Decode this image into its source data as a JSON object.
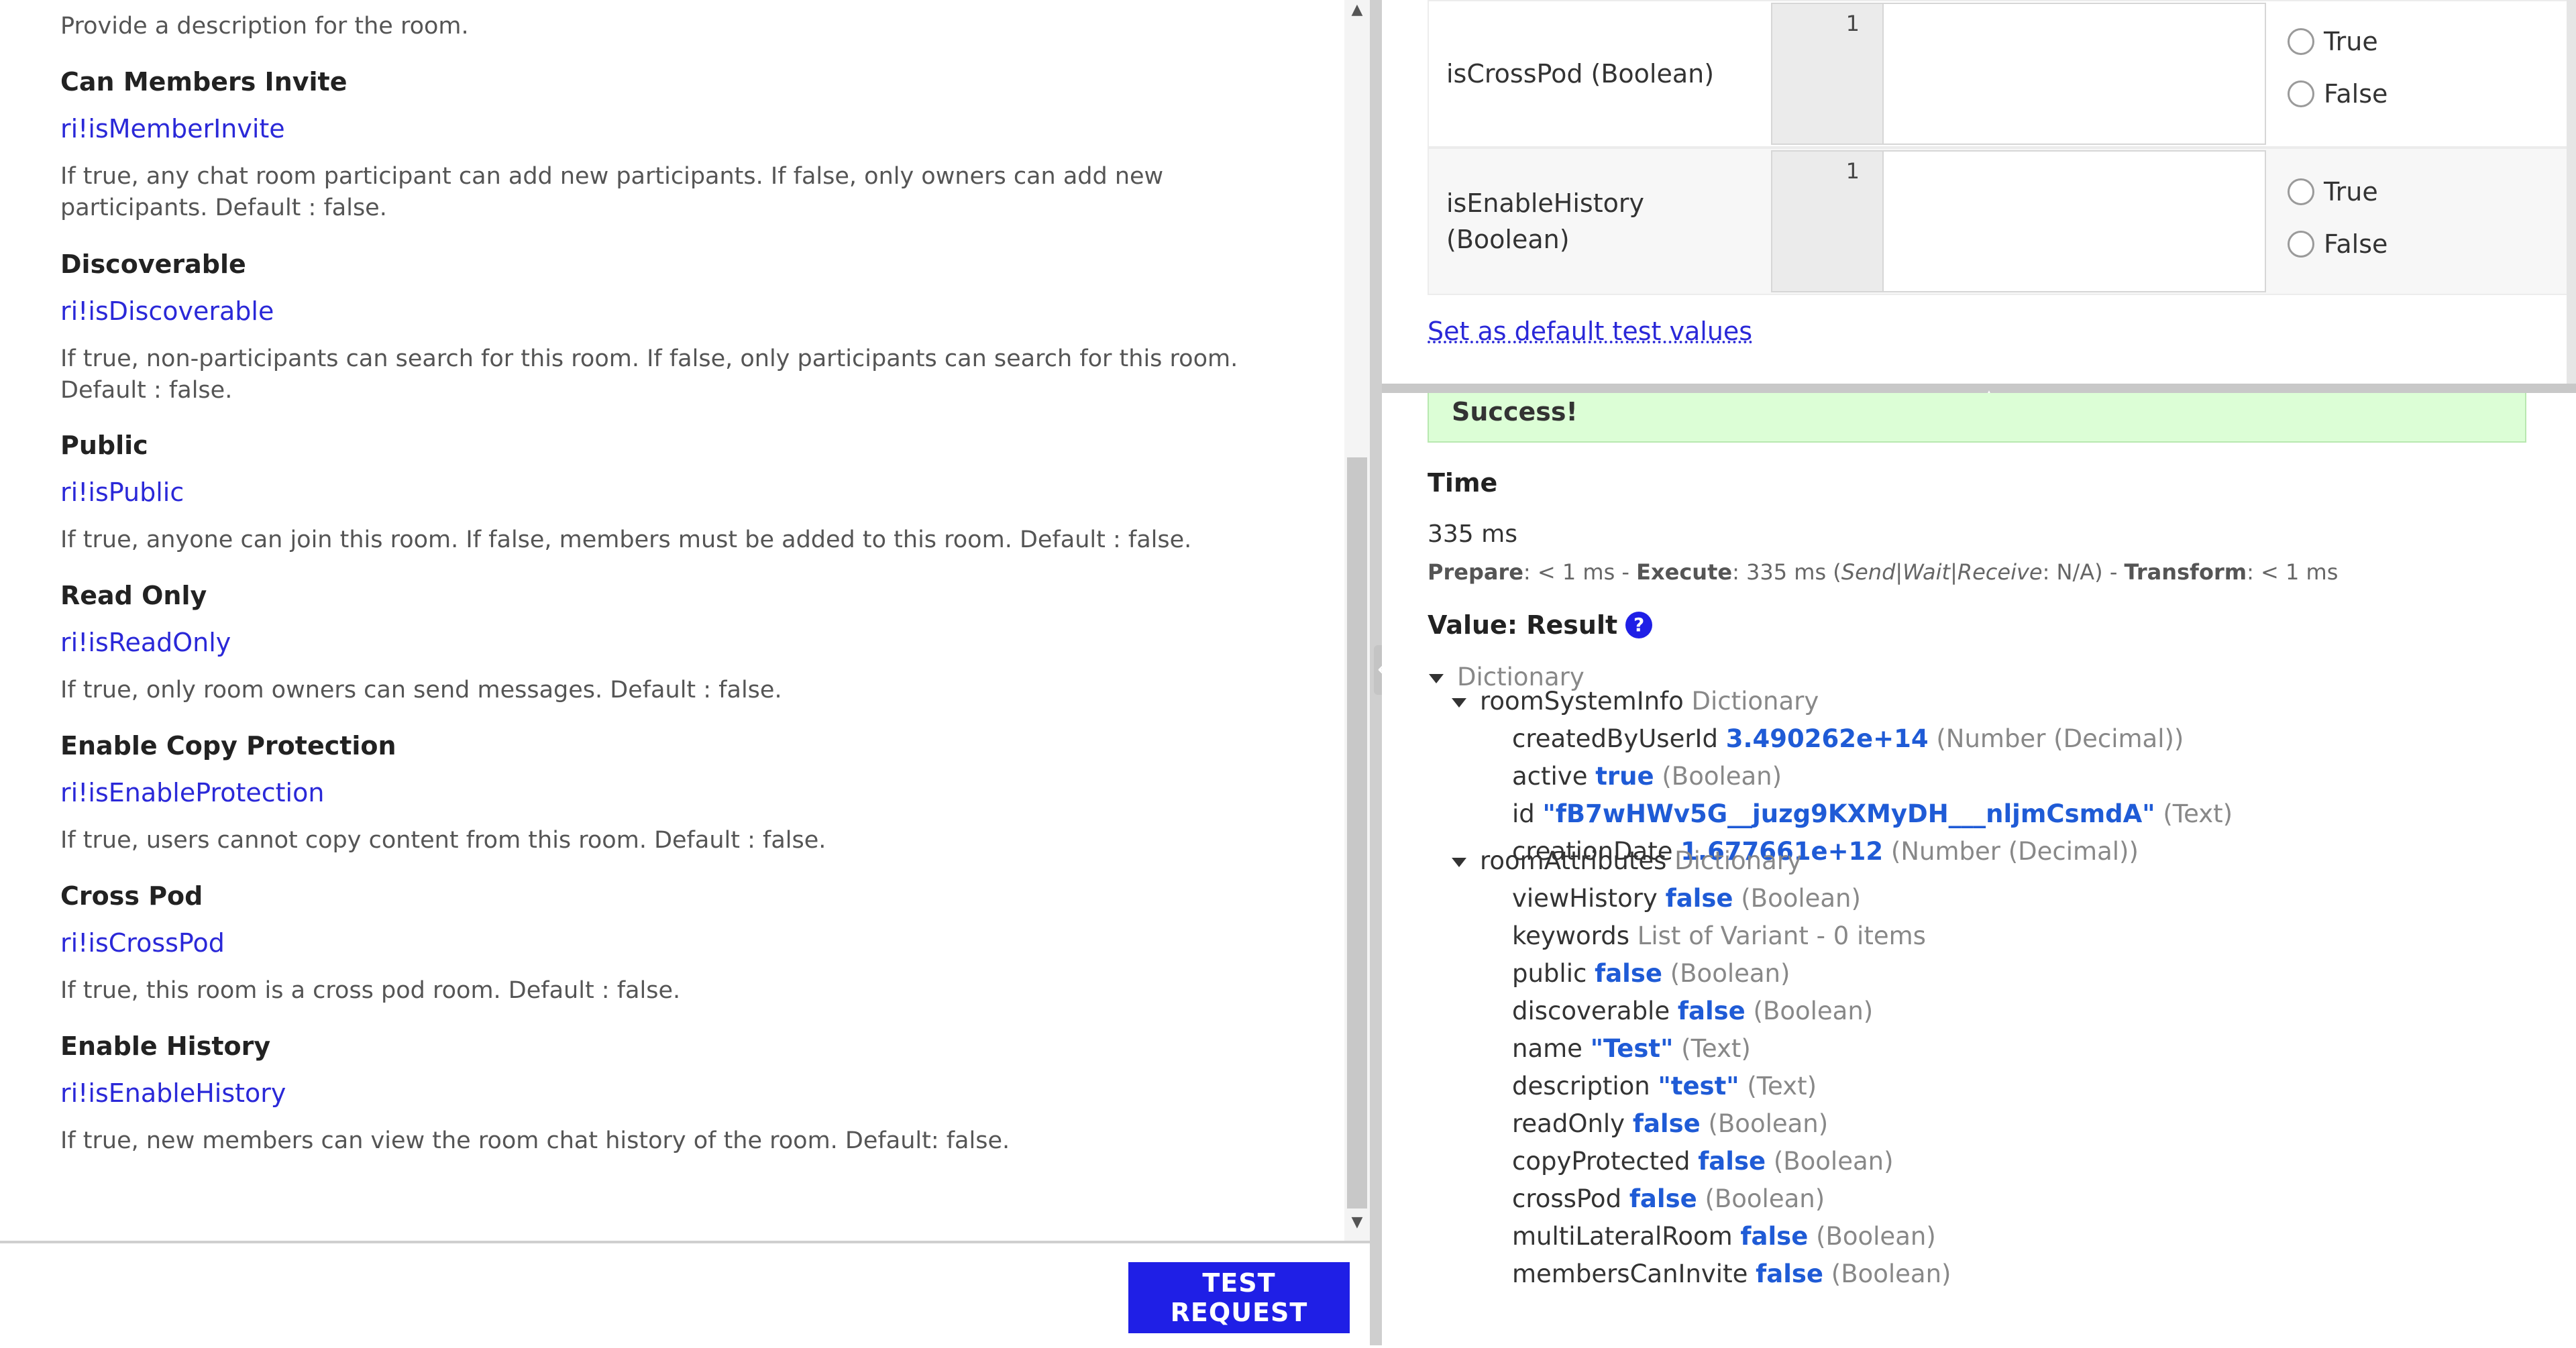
{
  "left": {
    "top_description": "Provide a description for the room.",
    "params": [
      {
        "title": "Can Members Invite",
        "rule": "ri!isMemberInvite",
        "description": "If true, any chat room participant can add new participants. If false, only owners can add new participants. Default : false."
      },
      {
        "title": "Discoverable",
        "rule": "ri!isDiscoverable",
        "description": "If true, non-participants can search for this room. If false, only participants can search for this room. Default : false."
      },
      {
        "title": "Public",
        "rule": "ri!isPublic",
        "description": "If true, anyone can join this room. If false, members must be added to this room. Default : false."
      },
      {
        "title": "Read Only",
        "rule": "ri!isReadOnly",
        "description": "If true, only room owners can send messages. Default : false."
      },
      {
        "title": "Enable Copy Protection",
        "rule": "ri!isEnableProtection",
        "description": "If true, users cannot copy content from this room. Default : false."
      },
      {
        "title": "Cross Pod",
        "rule": "ri!isCrossPod",
        "description": "If true, this room is a cross pod room. Default : false."
      },
      {
        "title": "Enable History",
        "rule": "ri!isEnableHistory",
        "description": "If true, new members can view the room chat history of the room. Default: false."
      }
    ],
    "test_request_label": "TEST REQUEST"
  },
  "inputs": [
    {
      "name": "isCrossPod (Boolean)",
      "line_number": "1",
      "true_label": "True",
      "false_label": "False"
    },
    {
      "name": "isEnableHistory (Boolean)",
      "line_number": "1",
      "true_label": "True",
      "false_label": "False"
    }
  ],
  "set_default_label": "Set as default test values",
  "result": {
    "status": "Success!",
    "time_label": "Time",
    "time_value": "335 ms",
    "timing": {
      "prepare_label": "Prepare",
      "prepare_value": ": < 1 ms - ",
      "execute_label": "Execute",
      "execute_value": ": 335 ms (",
      "phases": "Send|Wait|Receive",
      "phases_value": ": N/A) - ",
      "transform_label": "Transform",
      "transform_value": ": < 1 ms"
    },
    "value_title": "Value: Result",
    "help_icon": "?",
    "tree": {
      "root_type": "Dictionary",
      "system_info": {
        "key": "roomSystemInfo",
        "type": "Dictionary",
        "fields": [
          {
            "key": "createdByUserId",
            "value": "3.490262e+14",
            "type": "(Number (Decimal))"
          },
          {
            "key": "active",
            "value": "true",
            "type": "(Boolean)"
          },
          {
            "key": "id",
            "value": "\"fB7wHWv5G__juzg9KXMyDH___nljmCsmdA\"",
            "type": "(Text)"
          },
          {
            "key": "creationDate",
            "value": "1.677661e+12",
            "type": "(Number (Decimal))"
          }
        ]
      },
      "attributes": {
        "key": "roomAttributes",
        "type": "Dictionary",
        "fields": [
          {
            "key": "viewHistory",
            "value": "false",
            "type": "(Boolean)"
          },
          {
            "key": "keywords",
            "value": "",
            "type": "List of Variant - 0 items"
          },
          {
            "key": "public",
            "value": "false",
            "type": "(Boolean)"
          },
          {
            "key": "discoverable",
            "value": "false",
            "type": "(Boolean)"
          },
          {
            "key": "name",
            "value": "\"Test\"",
            "type": "(Text)"
          },
          {
            "key": "description",
            "value": "\"test\"",
            "type": "(Text)"
          },
          {
            "key": "readOnly",
            "value": "false",
            "type": "(Boolean)"
          },
          {
            "key": "copyProtected",
            "value": "false",
            "type": "(Boolean)"
          },
          {
            "key": "crossPod",
            "value": "false",
            "type": "(Boolean)"
          },
          {
            "key": "multiLateralRoom",
            "value": "false",
            "type": "(Boolean)"
          },
          {
            "key": "membersCanInvite",
            "value": "false",
            "type": "(Boolean)"
          }
        ]
      }
    }
  },
  "icons": {
    "scroll_up": "up-arrow-icon",
    "scroll_down": "down-arrow-icon",
    "collapse": "chevron-left-icon",
    "expand_up": "chevron-up-icon",
    "caret": "caret-down-icon"
  },
  "colors": {
    "link": "#2a28d8",
    "primary_button": "#1f1fe6",
    "success_bg": "#dcfed6",
    "value": "#1f5bd6"
  }
}
